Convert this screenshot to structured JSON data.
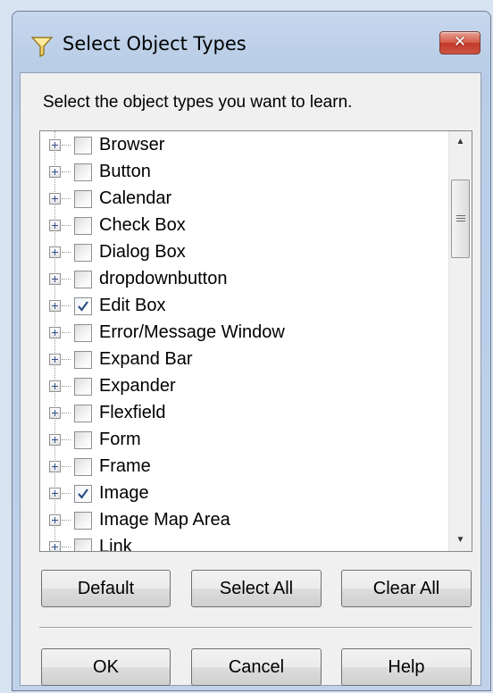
{
  "window": {
    "title": "Select Object Types",
    "close_label": "✕"
  },
  "instruction": "Select the object types you want to learn.",
  "items": [
    {
      "label": "Browser",
      "checked": false
    },
    {
      "label": "Button",
      "checked": false
    },
    {
      "label": "Calendar",
      "checked": false
    },
    {
      "label": "Check Box",
      "checked": false
    },
    {
      "label": "Dialog Box",
      "checked": false
    },
    {
      "label": "dropdownbutton",
      "checked": false
    },
    {
      "label": "Edit Box",
      "checked": true
    },
    {
      "label": "Error/Message Window",
      "checked": false
    },
    {
      "label": "Expand Bar",
      "checked": false
    },
    {
      "label": "Expander",
      "checked": false
    },
    {
      "label": "Flexfield",
      "checked": false
    },
    {
      "label": "Form",
      "checked": false
    },
    {
      "label": "Frame",
      "checked": false
    },
    {
      "label": "Image",
      "checked": true
    },
    {
      "label": "Image Map Area",
      "checked": false
    },
    {
      "label": "Link",
      "checked": false
    }
  ],
  "buttons": {
    "default": "Default",
    "select_all": "Select All",
    "clear_all": "Clear All",
    "ok": "OK",
    "cancel": "Cancel",
    "help": "Help"
  },
  "colors": {
    "title_bg": "#b9cde6",
    "close_red": "#c0392b",
    "check_blue": "#2d4f86"
  }
}
